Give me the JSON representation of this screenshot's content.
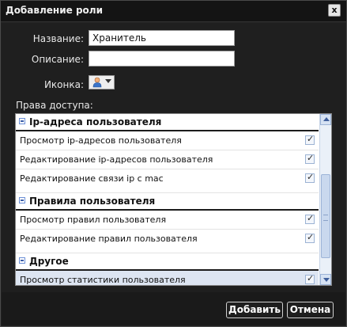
{
  "dialog": {
    "title": "Добавление роли",
    "close_label": "x"
  },
  "form": {
    "name_label": "Название:",
    "name_value": "Хранитель",
    "desc_label": "Описание:",
    "desc_value": "",
    "icon_label": "Иконка:",
    "icon": "user-icon",
    "rights_label": "Права доступа:"
  },
  "rights": {
    "groups": [
      {
        "title": "Ip-адреса пользователя",
        "items": [
          {
            "label": "Просмотр ip-адресов пользователя",
            "checked": true
          },
          {
            "label": "Редактирование ip-адресов пользователя",
            "checked": true
          },
          {
            "label": "Редактирование связи ip с mac",
            "checked": true
          }
        ]
      },
      {
        "title": "Правила пользователя",
        "items": [
          {
            "label": "Просмотр правил пользователя",
            "checked": true
          },
          {
            "label": "Редактирование правил пользователя",
            "checked": true
          }
        ]
      },
      {
        "title": "Другое",
        "items": [
          {
            "label": "Просмотр статистики пользователя",
            "checked": true,
            "selected": true
          }
        ]
      }
    ]
  },
  "buttons": {
    "add": "Добавить",
    "cancel": "Отмена"
  }
}
